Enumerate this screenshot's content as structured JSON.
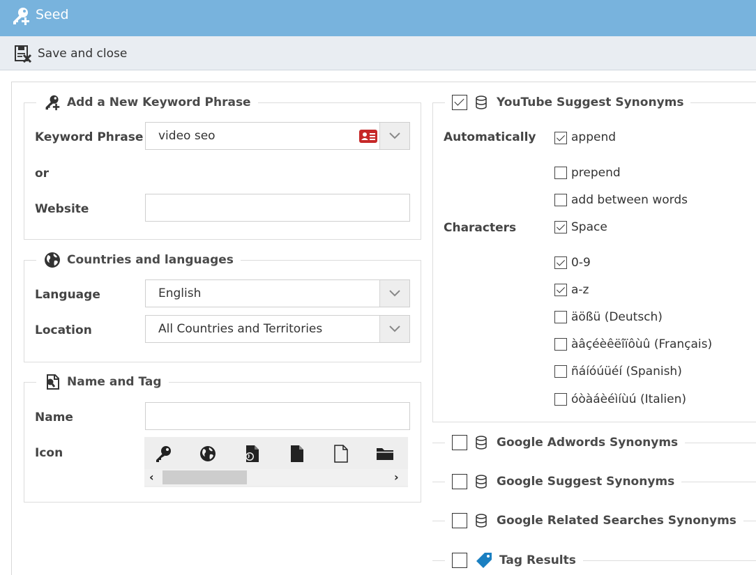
{
  "window": {
    "title": "Seed",
    "icon": "key-plus-icon"
  },
  "toolbar": {
    "save_close_label": "Save and close",
    "save_close_icon": "save-close-icon"
  },
  "keyword_section": {
    "legend": "Add a New Keyword Phrase",
    "keyword_label": "Keyword Phrase",
    "keyword_value": "video seo",
    "or_label": "or",
    "website_label": "Website",
    "website_value": ""
  },
  "countries_section": {
    "legend": "Countries and languages",
    "language_label": "Language",
    "language_value": "English",
    "location_label": "Location",
    "location_value": "All Countries and Territories"
  },
  "name_section": {
    "legend": "Name and Tag",
    "name_label": "Name",
    "name_value": "",
    "icon_label": "Icon",
    "icons": [
      "key-icon",
      "globe-icon",
      "file-globe-icon",
      "file-icon",
      "file-outline-icon",
      "folder-icon"
    ]
  },
  "youtube_section": {
    "checked": true,
    "legend": "YouTube Suggest Synonyms",
    "automatically_label": "Automatically",
    "characters_label": "Characters",
    "options": [
      {
        "label": "append",
        "checked": true
      },
      {
        "label": "prepend",
        "checked": false
      },
      {
        "label": "add between words",
        "checked": false
      },
      {
        "label": "Space",
        "checked": true
      },
      {
        "label": "0-9",
        "checked": true
      },
      {
        "label": "a-z",
        "checked": true
      },
      {
        "label": "äößü (Deutsch)",
        "checked": false
      },
      {
        "label": "àâçéèêëîïôùû (Français)",
        "checked": false
      },
      {
        "label": "ñáíóúüéí (Spanish)",
        "checked": false
      },
      {
        "label": "óòàáèéìíùú (Italien)",
        "checked": false
      }
    ]
  },
  "collapsed_sections": [
    {
      "label": "Google Adwords Synonyms",
      "checked": false,
      "icon": "database-icon"
    },
    {
      "label": "Google Suggest Synonyms",
      "checked": false,
      "icon": "database-icon"
    },
    {
      "label": "Google Related Searches Synonyms",
      "checked": false,
      "icon": "database-icon"
    },
    {
      "label": "Tag Results",
      "checked": false,
      "icon": "tag-icon"
    }
  ],
  "colors": {
    "titlebar": "#78b3dd",
    "toolbar": "#e9edf2",
    "tag_icon": "#1a7fc1",
    "contact_card_icon": "#c62828"
  }
}
